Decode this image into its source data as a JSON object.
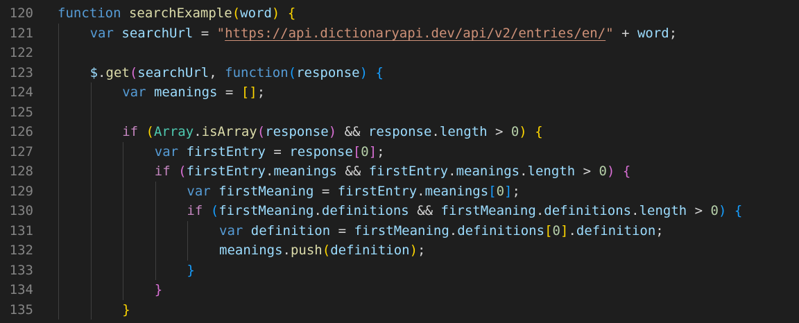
{
  "editor": {
    "language": "javascript",
    "theme": "dark",
    "colors": {
      "background": "#1e1e1e",
      "line_number": "#858585",
      "keyword": "#569cd6",
      "control": "#c586c0",
      "function": "#dcdcaa",
      "variable": "#9cdcfe",
      "string": "#ce9178",
      "number": "#b5cea8",
      "class": "#4ec9b0",
      "bracket_1": "#ffd700",
      "bracket_2": "#da70d6",
      "bracket_3": "#179fff"
    },
    "lines": [
      {
        "number": "120",
        "indent": 0,
        "tokens": [
          {
            "t": "function",
            "c": "kw"
          },
          {
            "t": " "
          },
          {
            "t": "searchExample",
            "c": "fn"
          },
          {
            "t": "(",
            "c": "b1"
          },
          {
            "t": "word",
            "c": "var"
          },
          {
            "t": ")",
            "c": "b1"
          },
          {
            "t": " "
          },
          {
            "t": "{",
            "c": "b1"
          }
        ]
      },
      {
        "number": "121",
        "indent": 1,
        "tokens": [
          {
            "t": "var",
            "c": "kw"
          },
          {
            "t": " "
          },
          {
            "t": "searchUrl",
            "c": "var"
          },
          {
            "t": " = ",
            "c": "op"
          },
          {
            "t": "\"",
            "c": "str"
          },
          {
            "t": "https://api.dictionaryapi.dev/api/v2/entries/en/",
            "c": "str link"
          },
          {
            "t": "\"",
            "c": "str"
          },
          {
            "t": " + ",
            "c": "op"
          },
          {
            "t": "word",
            "c": "var"
          },
          {
            "t": ";",
            "c": "op"
          }
        ]
      },
      {
        "number": "122",
        "indent": 0,
        "tokens": []
      },
      {
        "number": "123",
        "indent": 1,
        "tokens": [
          {
            "t": "$",
            "c": "var"
          },
          {
            "t": ".",
            "c": "op"
          },
          {
            "t": "get",
            "c": "fn"
          },
          {
            "t": "(",
            "c": "b2"
          },
          {
            "t": "searchUrl",
            "c": "var"
          },
          {
            "t": ", ",
            "c": "op"
          },
          {
            "t": "function",
            "c": "kw"
          },
          {
            "t": "(",
            "c": "b3"
          },
          {
            "t": "response",
            "c": "var"
          },
          {
            "t": ")",
            "c": "b3"
          },
          {
            "t": " "
          },
          {
            "t": "{",
            "c": "b3"
          }
        ]
      },
      {
        "number": "124",
        "indent": 2,
        "tokens": [
          {
            "t": "var",
            "c": "kw"
          },
          {
            "t": " "
          },
          {
            "t": "meanings",
            "c": "var"
          },
          {
            "t": " = ",
            "c": "op"
          },
          {
            "t": "[",
            "c": "b1"
          },
          {
            "t": "]",
            "c": "b1"
          },
          {
            "t": ";",
            "c": "op"
          }
        ]
      },
      {
        "number": "125",
        "indent": 0,
        "tokens": []
      },
      {
        "number": "126",
        "indent": 2,
        "tokens": [
          {
            "t": "if",
            "c": "ctl"
          },
          {
            "t": " "
          },
          {
            "t": "(",
            "c": "b1"
          },
          {
            "t": "Array",
            "c": "cls"
          },
          {
            "t": ".",
            "c": "op"
          },
          {
            "t": "isArray",
            "c": "fn"
          },
          {
            "t": "(",
            "c": "b2"
          },
          {
            "t": "response",
            "c": "var"
          },
          {
            "t": ")",
            "c": "b2"
          },
          {
            "t": " && ",
            "c": "op"
          },
          {
            "t": "response",
            "c": "var"
          },
          {
            "t": ".",
            "c": "op"
          },
          {
            "t": "length",
            "c": "var"
          },
          {
            "t": " > ",
            "c": "op"
          },
          {
            "t": "0",
            "c": "num"
          },
          {
            "t": ")",
            "c": "b1"
          },
          {
            "t": " "
          },
          {
            "t": "{",
            "c": "b1"
          }
        ]
      },
      {
        "number": "127",
        "indent": 3,
        "tokens": [
          {
            "t": "var",
            "c": "kw"
          },
          {
            "t": " "
          },
          {
            "t": "firstEntry",
            "c": "var"
          },
          {
            "t": " = ",
            "c": "op"
          },
          {
            "t": "response",
            "c": "var"
          },
          {
            "t": "[",
            "c": "b2"
          },
          {
            "t": "0",
            "c": "num"
          },
          {
            "t": "]",
            "c": "b2"
          },
          {
            "t": ";",
            "c": "op"
          }
        ]
      },
      {
        "number": "128",
        "indent": 3,
        "tokens": [
          {
            "t": "if",
            "c": "ctl"
          },
          {
            "t": " "
          },
          {
            "t": "(",
            "c": "b2"
          },
          {
            "t": "firstEntry",
            "c": "var"
          },
          {
            "t": ".",
            "c": "op"
          },
          {
            "t": "meanings",
            "c": "var"
          },
          {
            "t": " && ",
            "c": "op"
          },
          {
            "t": "firstEntry",
            "c": "var"
          },
          {
            "t": ".",
            "c": "op"
          },
          {
            "t": "meanings",
            "c": "var"
          },
          {
            "t": ".",
            "c": "op"
          },
          {
            "t": "length",
            "c": "var"
          },
          {
            "t": " > ",
            "c": "op"
          },
          {
            "t": "0",
            "c": "num"
          },
          {
            "t": ")",
            "c": "b2"
          },
          {
            "t": " "
          },
          {
            "t": "{",
            "c": "b2"
          }
        ]
      },
      {
        "number": "129",
        "indent": 4,
        "tokens": [
          {
            "t": "var",
            "c": "kw"
          },
          {
            "t": " "
          },
          {
            "t": "firstMeaning",
            "c": "var"
          },
          {
            "t": " = ",
            "c": "op"
          },
          {
            "t": "firstEntry",
            "c": "var"
          },
          {
            "t": ".",
            "c": "op"
          },
          {
            "t": "meanings",
            "c": "var"
          },
          {
            "t": "[",
            "c": "b3"
          },
          {
            "t": "0",
            "c": "num"
          },
          {
            "t": "]",
            "c": "b3"
          },
          {
            "t": ";",
            "c": "op"
          }
        ]
      },
      {
        "number": "130",
        "indent": 4,
        "tokens": [
          {
            "t": "if",
            "c": "ctl"
          },
          {
            "t": " "
          },
          {
            "t": "(",
            "c": "b3"
          },
          {
            "t": "firstMeaning",
            "c": "var"
          },
          {
            "t": ".",
            "c": "op"
          },
          {
            "t": "definitions",
            "c": "var"
          },
          {
            "t": " && ",
            "c": "op"
          },
          {
            "t": "firstMeaning",
            "c": "var"
          },
          {
            "t": ".",
            "c": "op"
          },
          {
            "t": "definitions",
            "c": "var"
          },
          {
            "t": ".",
            "c": "op"
          },
          {
            "t": "length",
            "c": "var"
          },
          {
            "t": " > ",
            "c": "op"
          },
          {
            "t": "0",
            "c": "num"
          },
          {
            "t": ")",
            "c": "b3"
          },
          {
            "t": " "
          },
          {
            "t": "{",
            "c": "b3"
          }
        ]
      },
      {
        "number": "131",
        "indent": 5,
        "tokens": [
          {
            "t": "var",
            "c": "kw"
          },
          {
            "t": " "
          },
          {
            "t": "definition",
            "c": "var"
          },
          {
            "t": " = ",
            "c": "op"
          },
          {
            "t": "firstMeaning",
            "c": "var"
          },
          {
            "t": ".",
            "c": "op"
          },
          {
            "t": "definitions",
            "c": "var"
          },
          {
            "t": "[",
            "c": "b1"
          },
          {
            "t": "0",
            "c": "num"
          },
          {
            "t": "]",
            "c": "b1"
          },
          {
            "t": ".",
            "c": "op"
          },
          {
            "t": "definition",
            "c": "var"
          },
          {
            "t": ";",
            "c": "op"
          }
        ]
      },
      {
        "number": "132",
        "indent": 5,
        "tokens": [
          {
            "t": "meanings",
            "c": "var"
          },
          {
            "t": ".",
            "c": "op"
          },
          {
            "t": "push",
            "c": "fn"
          },
          {
            "t": "(",
            "c": "b1"
          },
          {
            "t": "definition",
            "c": "var"
          },
          {
            "t": ")",
            "c": "b1"
          },
          {
            "t": ";",
            "c": "op"
          }
        ]
      },
      {
        "number": "133",
        "indent": 4,
        "tokens": [
          {
            "t": "}",
            "c": "b3"
          }
        ]
      },
      {
        "number": "134",
        "indent": 3,
        "tokens": [
          {
            "t": "}",
            "c": "b2"
          }
        ]
      },
      {
        "number": "135",
        "indent": 2,
        "tokens": [
          {
            "t": "}",
            "c": "b1"
          }
        ]
      }
    ]
  }
}
